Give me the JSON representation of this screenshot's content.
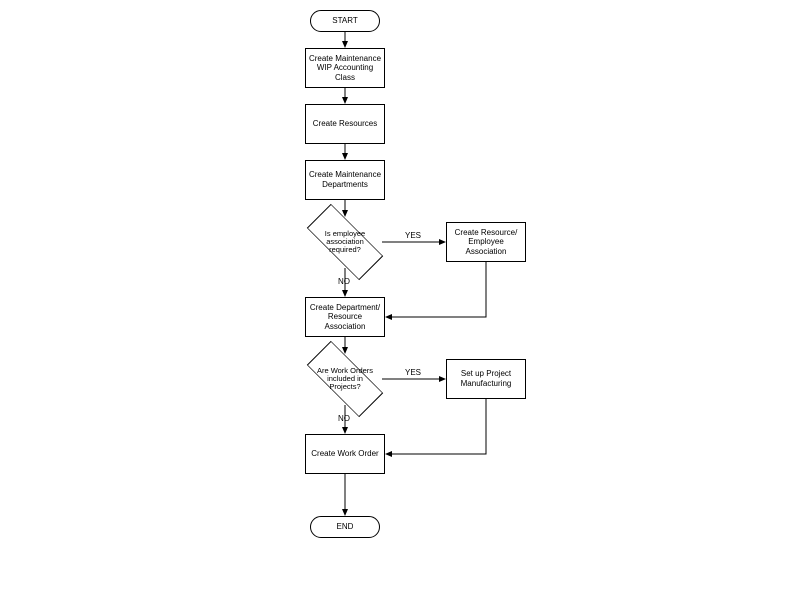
{
  "chart_data": {
    "type": "flowchart",
    "title": "",
    "nodes": [
      {
        "id": "start",
        "type": "terminator",
        "label": "START"
      },
      {
        "id": "n1",
        "type": "process",
        "label": "Create Maintenance WIP Accounting Class"
      },
      {
        "id": "n2",
        "type": "process",
        "label": "Create Resources"
      },
      {
        "id": "n3",
        "type": "process",
        "label": "Create Maintenance Departments"
      },
      {
        "id": "d1",
        "type": "decision",
        "label": "Is employee association required?"
      },
      {
        "id": "n4",
        "type": "process",
        "label": "Create Resource/ Employee Association"
      },
      {
        "id": "n5",
        "type": "process",
        "label": "Create Department/ Resource Association"
      },
      {
        "id": "d2",
        "type": "decision",
        "label": "Are Work Orders included in Projects?"
      },
      {
        "id": "n6",
        "type": "process",
        "label": "Set up Project Manufacturing"
      },
      {
        "id": "n7",
        "type": "process",
        "label": "Create Work Order"
      },
      {
        "id": "end",
        "type": "terminator",
        "label": "END"
      }
    ],
    "edges": [
      {
        "from": "start",
        "to": "n1",
        "label": ""
      },
      {
        "from": "n1",
        "to": "n2",
        "label": ""
      },
      {
        "from": "n2",
        "to": "n3",
        "label": ""
      },
      {
        "from": "n3",
        "to": "d1",
        "label": ""
      },
      {
        "from": "d1",
        "to": "n4",
        "label": "YES"
      },
      {
        "from": "d1",
        "to": "n5",
        "label": "NO"
      },
      {
        "from": "n4",
        "to": "n5",
        "label": ""
      },
      {
        "from": "n5",
        "to": "d2",
        "label": ""
      },
      {
        "from": "d2",
        "to": "n6",
        "label": "YES"
      },
      {
        "from": "d2",
        "to": "n7",
        "label": "NO"
      },
      {
        "from": "n6",
        "to": "n7",
        "label": ""
      },
      {
        "from": "n7",
        "to": "end",
        "label": ""
      }
    ]
  }
}
